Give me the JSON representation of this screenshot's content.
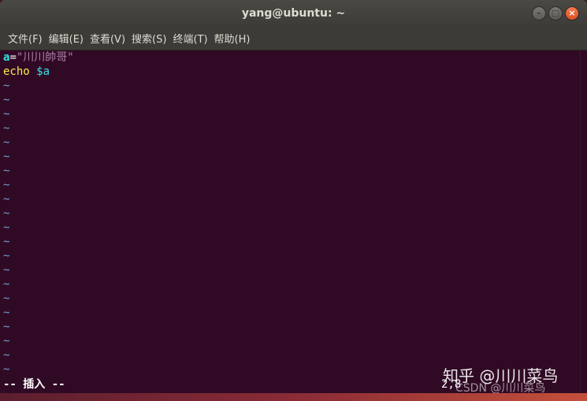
{
  "window": {
    "title": "yang@ubuntu: ~",
    "buttons": {
      "minimize": "–",
      "maximize": "□",
      "close": "×"
    }
  },
  "menubar": {
    "items": [
      {
        "label": "文件(F)"
      },
      {
        "label": "编辑(E)"
      },
      {
        "label": "查看(V)"
      },
      {
        "label": "搜索(S)"
      },
      {
        "label": "终端(T)"
      },
      {
        "label": "帮助(H)"
      }
    ]
  },
  "editor": {
    "line1": {
      "var": "a",
      "eq": "=",
      "value": "\"川川帥哥\""
    },
    "line2": {
      "cmd": "echo",
      "arg": "$a"
    },
    "tilde": "~",
    "mode": "-- 插入 --",
    "cursor_pos": "2,8"
  },
  "watermarks": {
    "zhihu": "知乎 @川川菜鸟",
    "csdn": "CSDN @川川菜鸟"
  },
  "colors": {
    "terminal_bg": "#300a24",
    "titlebar": "#3c3b37",
    "close_button": "#e95420"
  }
}
